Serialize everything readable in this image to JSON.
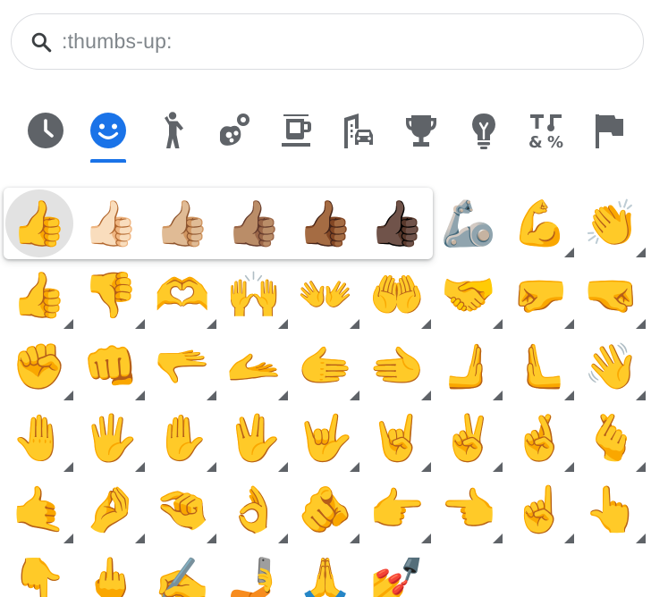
{
  "search": {
    "value": ":thumbs-up:",
    "icon": "search-icon"
  },
  "categories": [
    {
      "name": "recent",
      "icon": "clock-icon"
    },
    {
      "name": "smileys",
      "icon": "smiley-icon",
      "active": true
    },
    {
      "name": "people",
      "icon": "person-icon"
    },
    {
      "name": "nature",
      "icon": "flower-icon"
    },
    {
      "name": "food",
      "icon": "coffee-icon"
    },
    {
      "name": "travel",
      "icon": "car-building-icon"
    },
    {
      "name": "activities",
      "icon": "trophy-icon"
    },
    {
      "name": "objects",
      "icon": "lightbulb-icon"
    },
    {
      "name": "symbols",
      "icon": "symbols-icon"
    },
    {
      "name": "flags",
      "icon": "flag-icon"
    }
  ],
  "colors": {
    "icon": "#5f6368",
    "accent": "#1a73e8",
    "popup_selected": "#e2e2e2"
  },
  "skin_tones": [
    "👍",
    "👍🏻",
    "👍🏼",
    "👍🏽",
    "👍🏾",
    "👍🏿"
  ],
  "grid_rows": [
    [
      "👍",
      "👍",
      "👍",
      "👍",
      "👍",
      "👍",
      "🦾",
      "💪",
      "👏"
    ],
    [
      "👍",
      "👎",
      "🫶",
      "🙌",
      "👐",
      "🤲",
      "🤝",
      "🤛",
      "🤜"
    ],
    [
      "✊",
      "👊",
      "🫳",
      "🫴",
      "🫱",
      "🫲",
      "🫸",
      "🫷",
      "👋"
    ],
    [
      "🤚",
      "🖐️",
      "✋",
      "🖖",
      "🤟",
      "🤘",
      "✌️",
      "🤞",
      "🫰"
    ],
    [
      "🤙",
      "🤌",
      "🤏",
      "👌",
      "🫵",
      "👉",
      "👈",
      "☝️",
      "👆"
    ],
    [
      "👇",
      "🖕",
      "✍️",
      "🤳",
      "🙏",
      "💅"
    ]
  ],
  "grid_variants": [
    [
      false,
      false,
      false,
      false,
      false,
      false,
      false,
      true,
      true
    ],
    [
      true,
      true,
      true,
      true,
      true,
      true,
      true,
      true,
      true
    ],
    [
      true,
      true,
      true,
      true,
      true,
      true,
      true,
      true,
      true
    ],
    [
      true,
      true,
      true,
      true,
      true,
      true,
      true,
      true,
      true
    ],
    [
      true,
      true,
      true,
      true,
      true,
      true,
      true,
      true,
      true
    ],
    [
      true,
      true,
      true,
      true,
      true,
      true
    ]
  ]
}
